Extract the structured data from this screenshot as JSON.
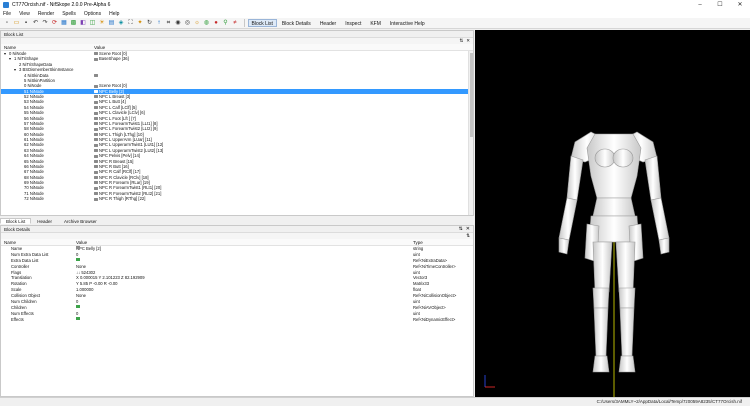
{
  "window": {
    "title": "CT77Orcish.nif - NifSkope 2.0.0 Pre-Alpha 6",
    "controls": [
      "–",
      "☐",
      "✕"
    ]
  },
  "menu": [
    "File",
    "View",
    "Render",
    "Spells",
    "Options",
    "Help"
  ],
  "toolbar": {
    "buttons": [
      {
        "name": "new-icon",
        "glyph": "▫",
        "cls": ""
      },
      {
        "name": "open-icon",
        "glyph": "▭",
        "cls": "c3"
      },
      {
        "name": "save-icon",
        "glyph": "▪",
        "cls": ""
      },
      {
        "name": "undo-icon",
        "glyph": "↶",
        "cls": ""
      },
      {
        "name": "redo-icon",
        "glyph": "↷",
        "cls": ""
      },
      {
        "name": "reload-icon",
        "glyph": "⟳",
        "cls": "c4"
      },
      {
        "name": "select-object-icon",
        "glyph": "▦",
        "cls": "c1"
      },
      {
        "name": "textures-icon",
        "glyph": "▩",
        "cls": "c2"
      },
      {
        "name": "vertex-colors-icon",
        "glyph": "◧",
        "cls": "c5"
      },
      {
        "name": "normals-icon",
        "glyph": "◫",
        "cls": "c2"
      },
      {
        "name": "lighting-icon",
        "glyph": "☀",
        "cls": "c3"
      },
      {
        "name": "gradient-icon",
        "glyph": "▤",
        "cls": "c1"
      },
      {
        "name": "skinning-icon",
        "glyph": "◈",
        "cls": "c6"
      },
      {
        "name": "fullscreen-icon",
        "glyph": "⛶",
        "cls": ""
      },
      {
        "name": "bulb-icon",
        "glyph": "✦",
        "cls": "c3"
      },
      {
        "name": "rotate-icon",
        "glyph": "↻",
        "cls": ""
      },
      {
        "name": "axes-icon",
        "glyph": "⟊",
        "cls": "c1"
      },
      {
        "name": "grid-icon",
        "glyph": "⌗",
        "cls": ""
      },
      {
        "name": "eye-icon",
        "glyph": "◉",
        "cls": ""
      },
      {
        "name": "view-icon",
        "glyph": "◎",
        "cls": ""
      },
      {
        "name": "light-direction-icon",
        "glyph": "☼",
        "cls": "c3"
      },
      {
        "name": "reset-view-icon",
        "glyph": "◍",
        "cls": "c2"
      },
      {
        "name": "marker-icon",
        "glyph": "●",
        "cls": "c4"
      },
      {
        "name": "pin-icon",
        "glyph": "⚲",
        "cls": "c2"
      },
      {
        "name": "unskin-icon",
        "glyph": "≠",
        "cls": "c4"
      }
    ],
    "text_buttons": [
      "Block List",
      "Block Details",
      "Header",
      "Inspect",
      "KFM",
      "Interactive Help"
    ]
  },
  "block_list": {
    "title": "Block List",
    "columns": [
      "Name",
      "Value"
    ],
    "rows": [
      {
        "indent": 0,
        "exp": "▾",
        "name": "0 NiNode",
        "value": "Scene Root [0]",
        "icon": true,
        "sel": false
      },
      {
        "indent": 1,
        "exp": "▾",
        "name": "1 NiTriShape",
        "value": "BaseShape [36]",
        "icon": true,
        "sel": false
      },
      {
        "indent": 2,
        "exp": "",
        "name": "2 NiTriShapeData",
        "value": "",
        "icon": false,
        "sel": false
      },
      {
        "indent": 2,
        "exp": "▾",
        "name": "3 BSDismemberSkinInstance",
        "value": "",
        "icon": false,
        "sel": false
      },
      {
        "indent": 3,
        "exp": "",
        "name": "4 NiSkinData",
        "value": "",
        "icon": true,
        "sel": false
      },
      {
        "indent": 3,
        "exp": "",
        "name": "5 NiSkinPartition",
        "value": "",
        "icon": false,
        "sel": false
      },
      {
        "indent": 3,
        "exp": "",
        "name": "0 NiNode",
        "value": "Scene Root [0]",
        "icon": true,
        "sel": false
      },
      {
        "indent": 3,
        "exp": "",
        "name": "51 NiNode",
        "value": "NPC Belly [2]",
        "icon": true,
        "sel": true
      },
      {
        "indent": 3,
        "exp": "",
        "name": "52 NiNode",
        "value": "NPC L Breast [3]",
        "icon": true,
        "sel": false
      },
      {
        "indent": 3,
        "exp": "",
        "name": "53 NiNode",
        "value": "NPC L Butt [4]",
        "icon": true,
        "sel": false
      },
      {
        "indent": 3,
        "exp": "",
        "name": "54 NiNode",
        "value": "NPC L Calf [LClf] [5]",
        "icon": true,
        "sel": false
      },
      {
        "indent": 3,
        "exp": "",
        "name": "55 NiNode",
        "value": "NPC L Clavicle [LClv] [6]",
        "icon": true,
        "sel": false
      },
      {
        "indent": 3,
        "exp": "",
        "name": "56 NiNode",
        "value": "NPC L Foot [Lft ] [7]",
        "icon": true,
        "sel": false
      },
      {
        "indent": 3,
        "exp": "",
        "name": "57 NiNode",
        "value": "NPC L ForearmTwist1 [LLt1] [8]",
        "icon": true,
        "sel": false
      },
      {
        "indent": 3,
        "exp": "",
        "name": "58 NiNode",
        "value": "NPC L ForearmTwist2 [LLt2] [9]",
        "icon": true,
        "sel": false
      },
      {
        "indent": 3,
        "exp": "",
        "name": "60 NiNode",
        "value": "NPC L Thigh [LThg] [10]",
        "icon": true,
        "sel": false
      },
      {
        "indent": 3,
        "exp": "",
        "name": "61 NiNode",
        "value": "NPC L UpperArm [LUar] [11]",
        "icon": true,
        "sel": false
      },
      {
        "indent": 3,
        "exp": "",
        "name": "62 NiNode",
        "value": "NPC L UpperarmTwist1 [LUt1] [12]",
        "icon": true,
        "sel": false
      },
      {
        "indent": 3,
        "exp": "",
        "name": "63 NiNode",
        "value": "NPC L UpperarmTwist2 [LUt2] [13]",
        "icon": true,
        "sel": false
      },
      {
        "indent": 3,
        "exp": "",
        "name": "64 NiNode",
        "value": "NPC Pelvis [Pelv] [14]",
        "icon": true,
        "sel": false
      },
      {
        "indent": 3,
        "exp": "",
        "name": "65 NiNode",
        "value": "NPC R Breast [15]",
        "icon": true,
        "sel": false
      },
      {
        "indent": 3,
        "exp": "",
        "name": "66 NiNode",
        "value": "NPC R Butt [16]",
        "icon": true,
        "sel": false
      },
      {
        "indent": 3,
        "exp": "",
        "name": "67 NiNode",
        "value": "NPC R Calf [RClf] [17]",
        "icon": true,
        "sel": false
      },
      {
        "indent": 3,
        "exp": "",
        "name": "68 NiNode",
        "value": "NPC R Clavicle [RClv] [18]",
        "icon": true,
        "sel": false
      },
      {
        "indent": 3,
        "exp": "",
        "name": "69 NiNode",
        "value": "NPC R Forearm [RLar] [19]",
        "icon": true,
        "sel": false
      },
      {
        "indent": 3,
        "exp": "",
        "name": "70 NiNode",
        "value": "NPC R ForearmTwist1 [RLt1] [20]",
        "icon": true,
        "sel": false
      },
      {
        "indent": 3,
        "exp": "",
        "name": "71 NiNode",
        "value": "NPC R ForearmTwist2 [RLt2] [21]",
        "icon": true,
        "sel": false
      },
      {
        "indent": 3,
        "exp": "",
        "name": "72 NiNode",
        "value": "NPC R Thigh [RThg] [22]",
        "icon": true,
        "sel": false
      }
    ]
  },
  "tabs": [
    "Block List",
    "Header",
    "Archive Browser"
  ],
  "block_details": {
    "title": "Block Details",
    "columns": [
      "Name",
      "Value",
      "Type"
    ],
    "rows": [
      {
        "name": "Name",
        "value": "NPC Belly [2]",
        "type": "string",
        "vicon": "gray"
      },
      {
        "name": "Num Extra Data List",
        "value": "0",
        "type": "uint",
        "vicon": ""
      },
      {
        "name": "Extra Data List",
        "value": "",
        "type": "Ref<NiExtraData>",
        "vicon": "green"
      },
      {
        "name": "Controller",
        "value": "None",
        "type": "Ref<NiTimeController>",
        "vicon": ""
      },
      {
        "name": "Flags",
        "value": "↓↓ 524302",
        "type": "uint",
        "vicon": ""
      },
      {
        "name": "Translation",
        "value": "X 0.000015 Y 2.101223 Z 82.192909",
        "type": "Vector3",
        "vicon": ""
      },
      {
        "name": "Rotation",
        "value": "Y 5.85 P -0.00 R -0.00",
        "type": "Matrix33",
        "vicon": ""
      },
      {
        "name": "Scale",
        "value": "1.000000",
        "type": "float",
        "vicon": ""
      },
      {
        "name": "Collision Object",
        "value": "None",
        "type": "Ref<NiCollisionObject>",
        "vicon": ""
      },
      {
        "name": "Num Children",
        "value": "0",
        "type": "uint",
        "vicon": ""
      },
      {
        "name": "Children",
        "value": "",
        "type": "Ref<NiAVObject>",
        "vicon": "green"
      },
      {
        "name": "Num Effects",
        "value": "0",
        "type": "uint",
        "vicon": ""
      },
      {
        "name": "Effects",
        "value": "",
        "type": "Ref<NiDynamicEffect>",
        "vicon": "green"
      }
    ]
  },
  "panel_controls": [
    "⇅",
    "✕"
  ],
  "status": {
    "path": "C:/Users/3AMMLY~2/AppData/Local/Temp/7z0059A8235/CT77Orcish.nif"
  },
  "colors": {
    "selection": "#3399ff",
    "viewport_bg": "#000000",
    "model": "#f4f4f4",
    "axis_y": "#e8e800"
  }
}
